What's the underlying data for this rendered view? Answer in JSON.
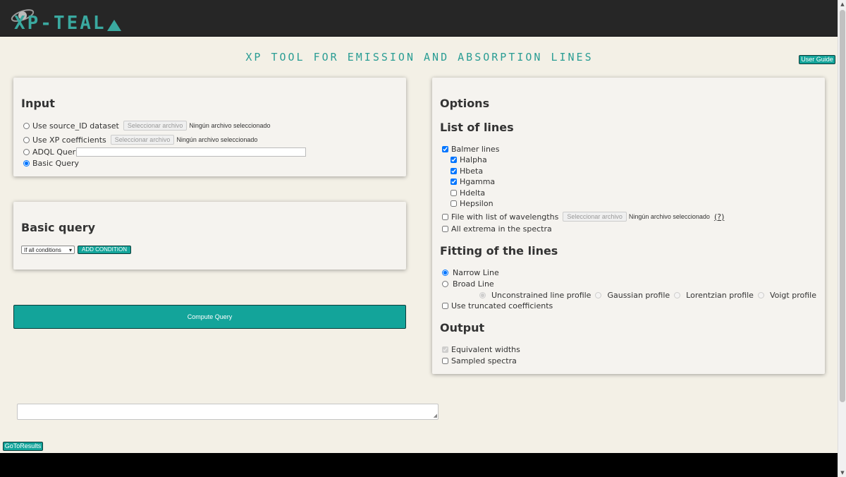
{
  "app": {
    "logo_text": "XP-TEAL",
    "title": "XP tool for emission and absorption lines",
    "user_guide": "User Guide"
  },
  "input_card": {
    "title": "Input",
    "options": [
      {
        "label": "Use source_ID dataset",
        "selected": false
      },
      {
        "label": "Use XP coefficients",
        "selected": false
      },
      {
        "label": "ADQL Query",
        "selected": false
      },
      {
        "label": "Basic Query",
        "selected": true
      }
    ],
    "file_button": "Seleccionar archivo",
    "file_status": "Ningún archivo seleccionado",
    "adql_value": ""
  },
  "basic_query_card": {
    "title": "Basic query",
    "condition_select": "If all conditions",
    "add_condition": "ADD CONDITION"
  },
  "compute_button": "Compute Query",
  "options_card": {
    "title": "Options",
    "list_title": "List of lines",
    "balmer": "Balmer lines",
    "lines": [
      {
        "label": "Halpha",
        "checked": true
      },
      {
        "label": "Hbeta",
        "checked": true
      },
      {
        "label": "Hgamma",
        "checked": true
      },
      {
        "label": "Hdelta",
        "checked": false
      },
      {
        "label": "Hepsilon",
        "checked": false
      }
    ],
    "file_wavelengths": "File with list of wavelengths",
    "file_button": "Seleccionar archivo",
    "file_status": "Ningún archivo seleccionado",
    "help": "(?)",
    "all_extrema": "All extrema in the spectra",
    "fitting_title": "Fitting of the lines",
    "narrow": "Narrow Line",
    "broad": "Broad Line",
    "profiles": [
      "Unconstrained line profile",
      "Gaussian profile",
      "Lorentzian profile",
      "Voigt profile"
    ],
    "truncated": "Use truncated coefficients",
    "output_title": "Output",
    "equivalent": "Equivalent widths",
    "sampled": "Sampled spectra"
  },
  "results_textarea": "",
  "goto_results": "GoToResults"
}
